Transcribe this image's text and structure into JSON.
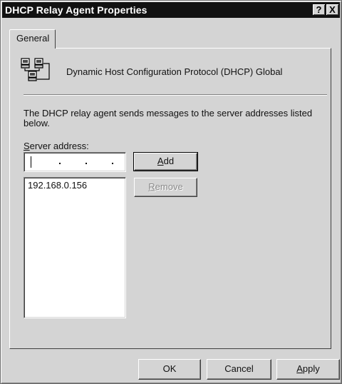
{
  "window": {
    "title": "DHCP Relay Agent Properties",
    "help_glyph": "?",
    "close_glyph": "X"
  },
  "tabs": [
    {
      "label": "General",
      "selected": true
    }
  ],
  "general": {
    "icon": "network-servers-icon",
    "title": "Dynamic Host Configuration Protocol (DHCP) Global",
    "info": "The DHCP relay agent sends messages to the server addresses listed below.",
    "server_label_access": "S",
    "server_label_rest": "erver address:",
    "ip_input_value": "",
    "add": {
      "access": "A",
      "pre": "",
      "post": "dd",
      "ul_after": true
    },
    "remove": {
      "access": "R",
      "post": "emove",
      "enabled": false
    },
    "server_list": [
      "192.168.0.156"
    ]
  },
  "footer": {
    "ok": "OK",
    "cancel": "Cancel",
    "apply_access": "A",
    "apply_rest": "pply"
  },
  "colors": {
    "face": "#d4d4d4",
    "titlebar": "#111111",
    "disabled_text": "#8a8a8a"
  }
}
